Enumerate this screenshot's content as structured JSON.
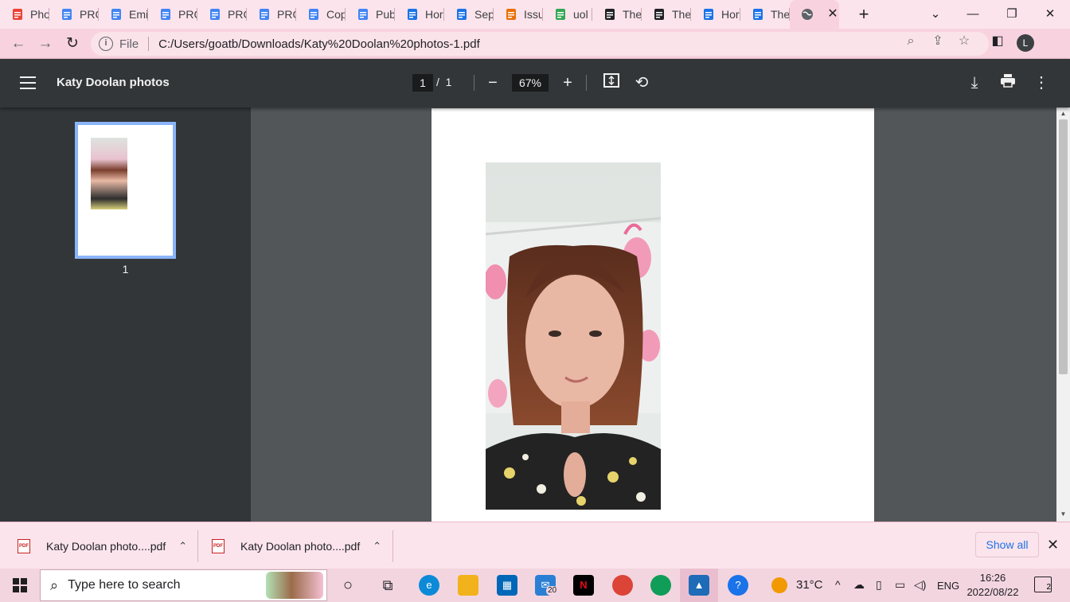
{
  "tabs": [
    {
      "label": "Pho",
      "icon": "google-photos-icon",
      "color": "#ea4335"
    },
    {
      "label": "PRC",
      "icon": "google-docs-icon",
      "color": "#4285f4"
    },
    {
      "label": "Emi",
      "icon": "google-docs-icon",
      "color": "#4285f4"
    },
    {
      "label": "PRC",
      "icon": "google-docs-icon",
      "color": "#4285f4"
    },
    {
      "label": "PRC",
      "icon": "google-docs-icon",
      "color": "#4285f4"
    },
    {
      "label": "PRC",
      "icon": "google-docs-icon",
      "color": "#4285f4"
    },
    {
      "label": "Cop",
      "icon": "google-docs-icon",
      "color": "#4285f4"
    },
    {
      "label": "Pub",
      "icon": "google-docs-icon",
      "color": "#4285f4"
    },
    {
      "label": "Hor",
      "icon": "c-logo-icon",
      "color": "#1a73e8"
    },
    {
      "label": "Sep",
      "icon": "c-logo-icon",
      "color": "#1a73e8"
    },
    {
      "label": "Issu",
      "icon": "target-icon",
      "color": "#e8710a"
    },
    {
      "label": "uol",
      "icon": "google-g-icon",
      "color": "#34a853"
    },
    {
      "label": "The",
      "icon": "openai-icon",
      "color": "#202124"
    },
    {
      "label": "The",
      "icon": "openai-icon",
      "color": "#202124"
    },
    {
      "label": "Hor",
      "icon": "c-logo-icon",
      "color": "#1a73e8"
    },
    {
      "label": "The",
      "icon": "c-logo-icon",
      "color": "#1a73e8"
    }
  ],
  "active_tab_icon": "globe-icon",
  "omnibox": {
    "scheme_label": "File",
    "url": "C:/Users/goatb/Downloads/Katy%20Doolan%20photos-1.pdf"
  },
  "profile_initial": "L",
  "pdf": {
    "title": "Katy Doolan photos",
    "current_page": "1",
    "page_separator": "/",
    "total_pages": "1",
    "zoom": "67%"
  },
  "sidebar": {
    "thumbnail_label": "1"
  },
  "downloads": {
    "items": [
      {
        "name": "Katy Doolan photo....pdf",
        "icon_text": "PDF"
      },
      {
        "name": "Katy Doolan photo....pdf",
        "icon_text": "PDF"
      }
    ],
    "show_all_label": "Show all"
  },
  "taskbar": {
    "search_placeholder": "Type here to search",
    "mail_badge": "20",
    "temperature": "31°C",
    "language": "ENG",
    "time": "16:26",
    "date": "2022/08/22",
    "notification_count": "2"
  },
  "colors": {
    "chrome_pink": "#fce4ec",
    "pdf_header": "#323639",
    "pdf_background": "#525659",
    "accent_blue": "#8ab4f8"
  }
}
